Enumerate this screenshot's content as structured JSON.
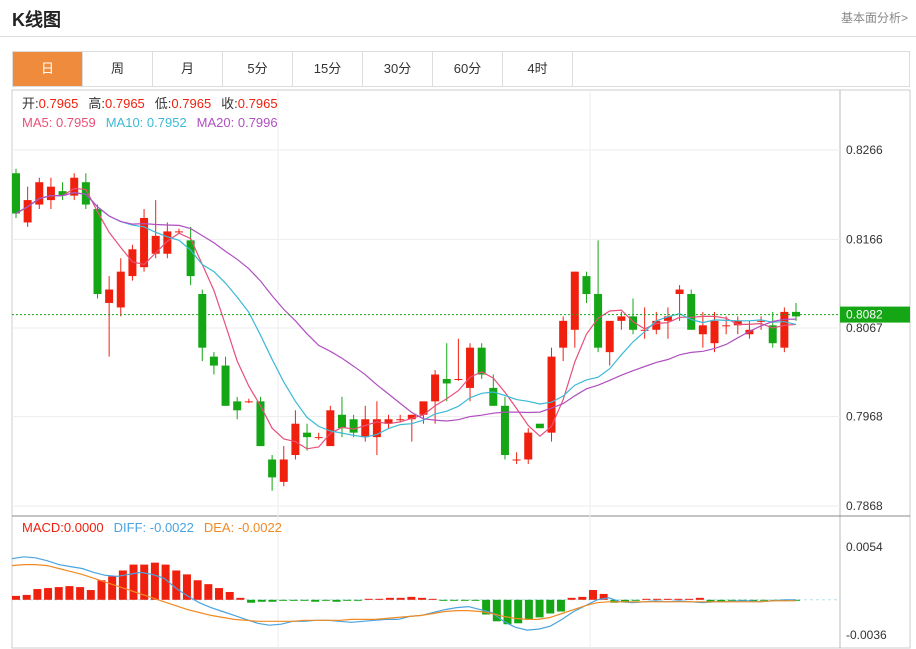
{
  "header": {
    "title": "K线图",
    "link": "基本面分析>"
  },
  "tabs": [
    {
      "label": "日",
      "active": true
    },
    {
      "label": "周",
      "active": false
    },
    {
      "label": "月",
      "active": false
    },
    {
      "label": "5分",
      "active": false
    },
    {
      "label": "15分",
      "active": false
    },
    {
      "label": "30分",
      "active": false
    },
    {
      "label": "60分",
      "active": false
    },
    {
      "label": "4时",
      "active": false
    }
  ],
  "info": {
    "open_label": "开:",
    "open": "0.7965",
    "high_label": "高:",
    "high": "0.7965",
    "low_label": "低:",
    "low": "0.7965",
    "close_label": "收:",
    "close": "0.7965",
    "ma5_label": "MA5:",
    "ma5": "0.7959",
    "ma10_label": "MA10:",
    "ma10": "0.7952",
    "ma20_label": "MA20:",
    "ma20": "0.7996"
  },
  "macd_info": {
    "macd_label": "MACD:",
    "macd": "0.0000",
    "diff_label": "DIFF:",
    "diff": "-0.0022",
    "dea_label": "DEA:",
    "dea": "-0.0022"
  },
  "colors": {
    "up": "#f0200f",
    "down": "#14a614",
    "ma5": "#e8507a",
    "ma10": "#3bb9d6",
    "ma20": "#b04fc0",
    "diff": "#4aa3df",
    "dea": "#f08a24",
    "current": "#14a614"
  },
  "chart_data": {
    "type": "candlestick",
    "price_axis": {
      "ticks": [
        "0.8266",
        "0.8166",
        "0.8067",
        "0.7968",
        "0.7868"
      ],
      "tick_values": [
        0.8266,
        0.8166,
        0.8067,
        0.7968,
        0.7868
      ],
      "range": [
        0.7868,
        0.8266
      ]
    },
    "current_price": "0.8082",
    "current_value": 0.8082,
    "macd_axis": {
      "ticks": [
        "0.0054",
        "-0.0036"
      ],
      "tick_values": [
        0.0054,
        -0.0036
      ]
    },
    "candles": [
      [
        0.824,
        0.8245,
        0.819,
        0.8195
      ],
      [
        0.8185,
        0.8225,
        0.818,
        0.821
      ],
      [
        0.8205,
        0.8235,
        0.82,
        0.823
      ],
      [
        0.821,
        0.8235,
        0.82,
        0.8225
      ],
      [
        0.822,
        0.823,
        0.821,
        0.8215
      ],
      [
        0.8215,
        0.824,
        0.821,
        0.8235
      ],
      [
        0.823,
        0.824,
        0.82,
        0.8205
      ],
      [
        0.82,
        0.8205,
        0.81,
        0.8105
      ],
      [
        0.8095,
        0.8125,
        0.8035,
        0.811
      ],
      [
        0.809,
        0.8145,
        0.808,
        0.813
      ],
      [
        0.8125,
        0.816,
        0.812,
        0.8155
      ],
      [
        0.8135,
        0.82,
        0.813,
        0.819
      ],
      [
        0.815,
        0.821,
        0.8145,
        0.817
      ],
      [
        0.815,
        0.8185,
        0.8145,
        0.8175
      ],
      [
        0.8175,
        0.8178,
        0.8172,
        0.8175
      ],
      [
        0.8165,
        0.818,
        0.8115,
        0.8125
      ],
      [
        0.8105,
        0.811,
        0.803,
        0.8045
      ],
      [
        0.8035,
        0.804,
        0.8015,
        0.8025
      ],
      [
        0.8025,
        0.8035,
        0.798,
        0.798
      ],
      [
        0.7985,
        0.799,
        0.7965,
        0.7975
      ],
      [
        0.7985,
        0.7988,
        0.7983,
        0.7985
      ],
      [
        0.7985,
        0.799,
        0.7935,
        0.7935
      ],
      [
        0.792,
        0.7925,
        0.7885,
        0.79
      ],
      [
        0.7895,
        0.7935,
        0.789,
        0.792
      ],
      [
        0.7925,
        0.7975,
        0.792,
        0.796
      ],
      [
        0.795,
        0.796,
        0.793,
        0.7945
      ],
      [
        0.7945,
        0.795,
        0.7942,
        0.7945
      ],
      [
        0.7935,
        0.798,
        0.7935,
        0.7975
      ],
      [
        0.797,
        0.799,
        0.7945,
        0.7955
      ],
      [
        0.7965,
        0.797,
        0.7945,
        0.795
      ],
      [
        0.7945,
        0.798,
        0.794,
        0.7965
      ],
      [
        0.7945,
        0.7985,
        0.7925,
        0.7965
      ],
      [
        0.796,
        0.797,
        0.7955,
        0.7965
      ],
      [
        0.7965,
        0.797,
        0.7962,
        0.7965
      ],
      [
        0.7965,
        0.797,
        0.794,
        0.797
      ],
      [
        0.797,
        0.7975,
        0.796,
        0.7985
      ],
      [
        0.7985,
        0.802,
        0.796,
        0.8015
      ],
      [
        0.801,
        0.805,
        0.7985,
        0.8005
      ],
      [
        0.801,
        0.8055,
        0.8008,
        0.801
      ],
      [
        0.8,
        0.805,
        0.7985,
        0.8045
      ],
      [
        0.8045,
        0.805,
        0.801,
        0.8015
      ],
      [
        0.8,
        0.8015,
        0.798,
        0.798
      ],
      [
        0.798,
        0.799,
        0.792,
        0.7925
      ],
      [
        0.792,
        0.7928,
        0.7915,
        0.792
      ],
      [
        0.792,
        0.7955,
        0.7915,
        0.795
      ],
      [
        0.796,
        0.7958,
        0.7955,
        0.7955
      ],
      [
        0.795,
        0.8045,
        0.794,
        0.8035
      ],
      [
        0.8045,
        0.808,
        0.803,
        0.8075
      ],
      [
        0.8065,
        0.813,
        0.8045,
        0.813
      ],
      [
        0.8125,
        0.813,
        0.8095,
        0.8105
      ],
      [
        0.8105,
        0.8165,
        0.804,
        0.8045
      ],
      [
        0.804,
        0.807,
        0.8025,
        0.8075
      ],
      [
        0.8075,
        0.8085,
        0.8065,
        0.808
      ],
      [
        0.808,
        0.81,
        0.806,
        0.8065
      ],
      [
        0.8065,
        0.809,
        0.8055,
        0.8065
      ],
      [
        0.8065,
        0.8085,
        0.806,
        0.8075
      ],
      [
        0.8075,
        0.809,
        0.8055,
        0.808
      ],
      [
        0.8105,
        0.8115,
        0.8075,
        0.811
      ],
      [
        0.8105,
        0.811,
        0.8065,
        0.8065
      ],
      [
        0.806,
        0.8085,
        0.8045,
        0.807
      ],
      [
        0.805,
        0.8085,
        0.804,
        0.8075
      ],
      [
        0.807,
        0.808,
        0.806,
        0.807
      ],
      [
        0.807,
        0.808,
        0.806,
        0.8075
      ],
      [
        0.806,
        0.8075,
        0.8055,
        0.8065
      ],
      [
        0.8075,
        0.808,
        0.8065,
        0.8075
      ],
      [
        0.807,
        0.8085,
        0.8045,
        0.805
      ],
      [
        0.8045,
        0.809,
        0.804,
        0.8085
      ],
      [
        0.8085,
        0.8095,
        0.8075,
        0.808
      ]
    ],
    "macd_bars": [
      0.0004,
      0.0005,
      0.0011,
      0.0012,
      0.0013,
      0.0014,
      0.0013,
      0.001,
      0.002,
      0.0024,
      0.003,
      0.0036,
      0.0036,
      0.0038,
      0.0036,
      0.003,
      0.0026,
      0.002,
      0.0016,
      0.0012,
      0.0008,
      0.0002,
      -0.0003,
      -0.0002,
      -0.0002,
      -0.0001,
      -0.0001,
      -0.0001,
      -0.0002,
      -0.0001,
      -0.0002,
      -0.0001,
      -0.0001,
      0.0001,
      0.0001,
      0.0002,
      0.0002,
      0.0003,
      0.0002,
      0.0001,
      -0.0001,
      -0.0001,
      -0.0001,
      -0.0001,
      -0.0015,
      -0.0022,
      -0.0025,
      -0.0024,
      -0.002,
      -0.0018,
      -0.0014,
      -0.0012,
      0.0002,
      0.0003,
      0.001,
      0.0006,
      -0.0003,
      -0.0002,
      -0.0001,
      0.0001,
      0.0001,
      0.0001,
      0.0001,
      0.0001,
      0.0002,
      -0.0002,
      -0.0002,
      -0.0001,
      -0.0001,
      -0.0002,
      -0.0001,
      -0.0001,
      -0.0001,
      -0.0001
    ],
    "macd_diff": [
      0.0042,
      0.0044,
      0.0043,
      0.004,
      0.0036,
      0.0034,
      0.0032,
      0.0028,
      0.0025,
      0.0024,
      0.0026,
      0.0028,
      0.0026,
      0.0022,
      0.0012,
      0.0004,
      -0.0003,
      -0.0008,
      -0.0012,
      -0.0016,
      -0.002,
      -0.0024,
      -0.0026,
      -0.0025,
      -0.0022,
      -0.0022,
      -0.0021,
      -0.0021,
      -0.0022,
      -0.0023,
      -0.0022,
      -0.0021,
      -0.002,
      -0.002,
      -0.0017,
      -0.0016,
      -0.0013,
      -0.001,
      -0.0008,
      -0.0007,
      -0.001,
      -0.0013,
      -0.0022,
      -0.0028,
      -0.0031,
      -0.003,
      -0.0027,
      -0.002,
      -0.0012,
      -0.0006,
      0.0,
      0.0002,
      -0.0002,
      -0.0003,
      -0.0002,
      -0.0001,
      -0.0002,
      -0.0001,
      -0.0002,
      -0.0003,
      -0.0002,
      -0.0002,
      -0.0001,
      -0.0001,
      -0.0002,
      -0.0001,
      0.0,
      0.0
    ],
    "macd_dea": [
      0.0035,
      0.0036,
      0.0036,
      0.0035,
      0.0032,
      0.0029,
      0.0026,
      0.0022,
      0.0018,
      0.0014,
      0.001,
      0.0006,
      0.0002,
      -0.0002,
      -0.0006,
      -0.001,
      -0.0013,
      -0.0016,
      -0.0018,
      -0.002,
      -0.0021,
      -0.0022,
      -0.0022,
      -0.0022,
      -0.0022,
      -0.0021,
      -0.0021,
      -0.0021,
      -0.0021,
      -0.002,
      -0.002,
      -0.002,
      -0.0019,
      -0.0018,
      -0.0017,
      -0.0016,
      -0.0014,
      -0.0012,
      -0.0011,
      -0.0011,
      -0.0012,
      -0.0014,
      -0.0017,
      -0.0019,
      -0.002,
      -0.002,
      -0.0018,
      -0.0014,
      -0.001,
      -0.0006,
      -0.0003,
      -0.0002,
      -0.0002,
      -0.0002,
      -0.0002,
      -0.0002,
      -0.0002,
      -0.0002,
      -0.0002,
      -0.0002,
      -0.0002,
      -0.0002,
      -0.0002,
      -0.0002,
      -0.0002,
      -0.0001,
      -0.0001,
      -0.0001
    ],
    "grid": true
  }
}
